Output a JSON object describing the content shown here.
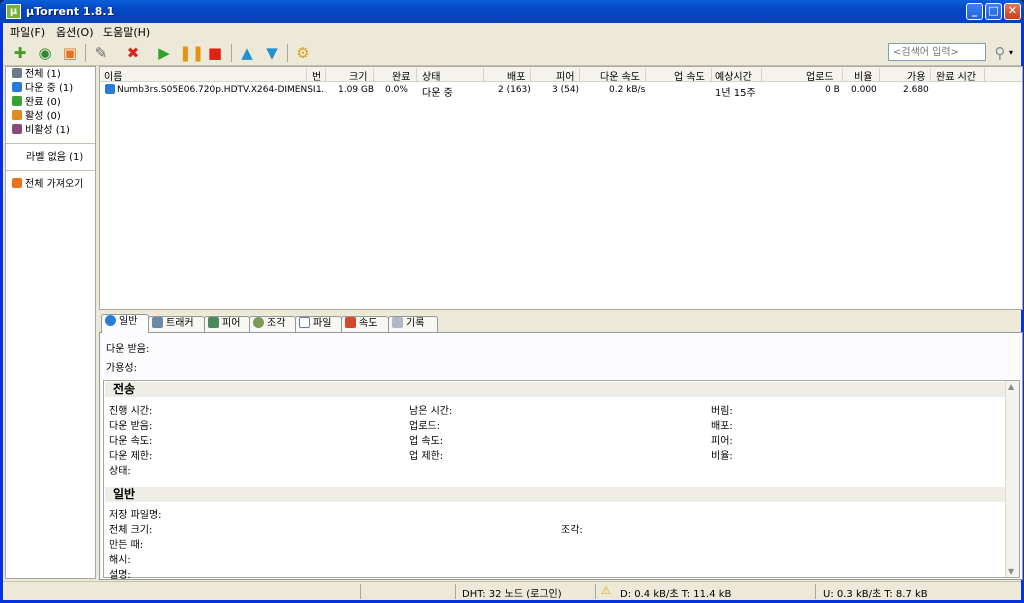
{
  "window": {
    "title": "µTorrent 1.8.1",
    "icon_text": "µ",
    "min": "_",
    "max": "□",
    "close": "✕"
  },
  "menu": [
    {
      "label": "파일(F)"
    },
    {
      "label": "옵션(O)"
    },
    {
      "label": "도움말(H)"
    }
  ],
  "toolbar": {
    "search_placeholder": "<검색어 입력>"
  },
  "sidebar": {
    "items": [
      {
        "label": "전체 (1)"
      },
      {
        "label": "다운 중 (1)"
      },
      {
        "label": "완료 (0)"
      },
      {
        "label": "활성 (0)"
      },
      {
        "label": "비활성 (1)"
      }
    ],
    "label_none": "라벨 없음 (1)",
    "feeds": "전체 가져오기"
  },
  "list": {
    "columns": [
      "이름",
      "번",
      "크기",
      "완료",
      "상태",
      "배포",
      "피어",
      "다운 속도",
      "업 속도",
      "예상시간",
      "업로드",
      "비율",
      "가용",
      "완료 시간"
    ],
    "rows": [
      {
        "name": "Numb3rs.S05E06.720p.HDTV.X264-DIMENSI...",
        "num": "1",
        "size": "1.09 GB",
        "done": "0.0%",
        "status": "다운 중",
        "seeds": "2 (163)",
        "peers": "3 (54)",
        "down": "0.2 kB/s",
        "up": "",
        "eta": "1년 15주",
        "uploaded": "0 B",
        "ratio": "0.000",
        "avail": "2.680",
        "completed": ""
      }
    ]
  },
  "tabs": [
    {
      "label": "일반"
    },
    {
      "label": "트래커"
    },
    {
      "label": "피어"
    },
    {
      "label": "조각"
    },
    {
      "label": "파일"
    },
    {
      "label": "속도"
    },
    {
      "label": "기록"
    }
  ],
  "general": {
    "downloaded": "다운 받음:",
    "availability": "가용성:",
    "transfer_title": "전송",
    "transfer": {
      "col1": [
        "진행 시간:",
        "다운 받음:",
        "다운 속도:",
        "다운 제한:",
        "상태:"
      ],
      "col2": [
        "남은 시간:",
        "업로드:",
        "업 속도:",
        "업 제한:"
      ],
      "col3": [
        "버림:",
        "배포:",
        "피어:",
        "비율:"
      ]
    },
    "general_title": "일반",
    "info": {
      "save_as": "저장 파일명:",
      "total_size": "전체 크기:",
      "created": "만든 때:",
      "hash": "해시:",
      "comment": "설명:",
      "pieces": "조각:"
    }
  },
  "status": {
    "dht": "DHT: 32 노드 (로그인)",
    "down": "D: 0.4 kB/초 T: 11.4 kB",
    "up": "U: 0.3 kB/초 T: 8.7 kB"
  }
}
